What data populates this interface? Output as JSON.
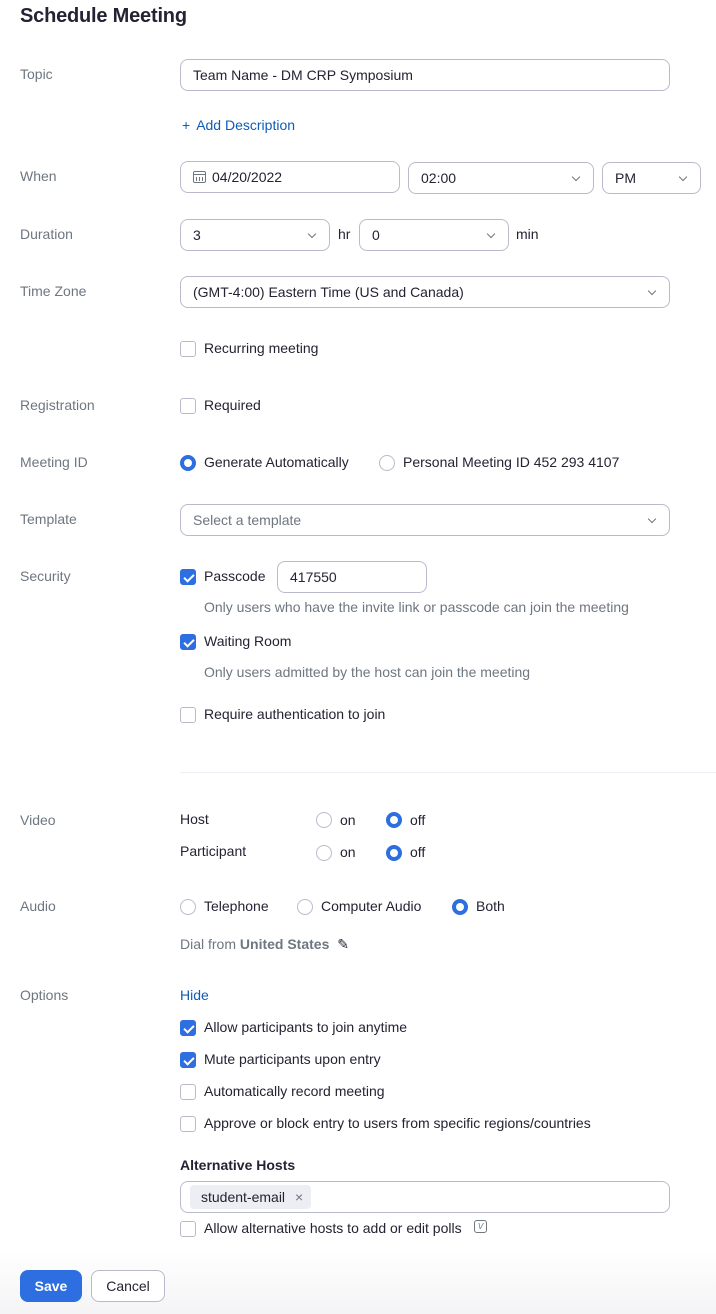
{
  "page": {
    "title": "Schedule Meeting"
  },
  "labels": {
    "topic": "Topic",
    "when": "When",
    "duration": "Duration",
    "time_zone": "Time Zone",
    "registration": "Registration",
    "meeting_id": "Meeting ID",
    "template": "Template",
    "security": "Security",
    "video": "Video",
    "audio": "Audio",
    "options": "Options"
  },
  "topic": {
    "value": "Team Name - DM CRP Symposium",
    "add_description": "Add Description",
    "add_icon": "+"
  },
  "when": {
    "date": "04/20/2022",
    "time": "02:00",
    "ampm": "PM"
  },
  "duration": {
    "hours": "3",
    "hours_unit": "hr",
    "minutes": "0",
    "minutes_unit": "min"
  },
  "time_zone": {
    "value": "(GMT-4:00) Eastern Time (US and Canada)"
  },
  "recurring": {
    "label": "Recurring meeting",
    "checked": false
  },
  "registration": {
    "label": "Required",
    "checked": false
  },
  "meeting_id": {
    "options": [
      {
        "label": "Generate Automatically",
        "selected": true
      },
      {
        "label": "Personal Meeting ID 452 293 4107",
        "selected": false
      }
    ]
  },
  "template": {
    "placeholder": "Select a template"
  },
  "security": {
    "passcode": {
      "label": "Passcode",
      "checked": true,
      "value": "417550",
      "hint": "Only users who have the invite link or passcode can join the meeting"
    },
    "waiting_room": {
      "label": "Waiting Room",
      "checked": true,
      "hint": "Only users admitted by the host can join the meeting"
    },
    "auth": {
      "label": "Require authentication to join",
      "checked": false
    }
  },
  "video": {
    "host": {
      "label": "Host",
      "on": "on",
      "off": "off",
      "selected": "off"
    },
    "participant": {
      "label": "Participant",
      "on": "on",
      "off": "off",
      "selected": "off"
    }
  },
  "audio": {
    "options": [
      {
        "label": "Telephone",
        "selected": false
      },
      {
        "label": "Computer Audio",
        "selected": false
      },
      {
        "label": "Both",
        "selected": true
      }
    ],
    "dial_from_prefix": "Dial from",
    "dial_from_country": "United States"
  },
  "options": {
    "toggle": "Hide",
    "items": [
      {
        "label": "Allow participants to join anytime",
        "checked": true
      },
      {
        "label": "Mute participants upon entry",
        "checked": true
      },
      {
        "label": "Automatically record meeting",
        "checked": false
      },
      {
        "label": "Approve or block entry to users from specific regions/countries",
        "checked": false
      }
    ],
    "alt_hosts_title": "Alternative Hosts",
    "alt_hosts": [
      "student-email"
    ],
    "alt_hosts_remove": "×",
    "polls": {
      "label": "Allow alternative hosts to add or edit polls",
      "checked": false,
      "icon_glyph": "V"
    }
  },
  "footer": {
    "save": "Save",
    "cancel": "Cancel"
  },
  "colors": {
    "accent": "#2d6ee0",
    "link": "#0e5cb8",
    "label": "#6e7680",
    "border": "#babacc"
  }
}
